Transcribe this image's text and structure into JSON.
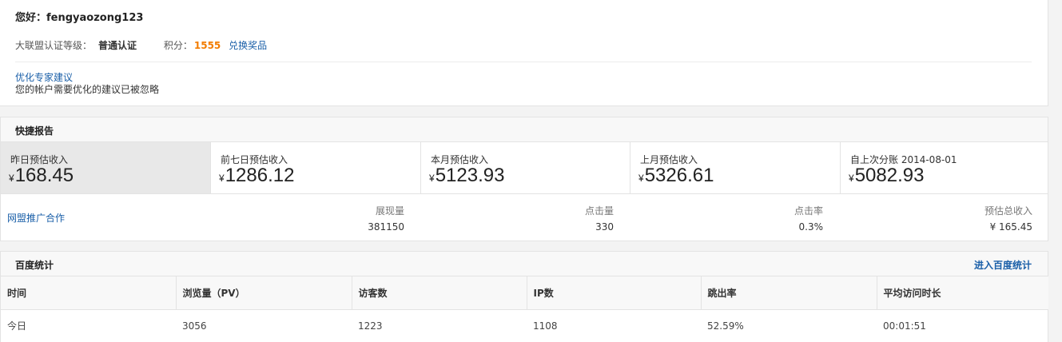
{
  "header": {
    "greeting": "您好：fengyaozong123",
    "level_label": "大联盟认证等级：",
    "level_value": "普通认证",
    "points_label": "积分：",
    "points_value": "1555",
    "redeem_link": "兑换奖品",
    "optimize_link": "优化专家建议",
    "optimize_text": "您的帐户需要优化的建议已被忽略"
  },
  "quick_report": {
    "title": "快捷报告",
    "currency": "¥",
    "cards": [
      {
        "label": "昨日预估收入",
        "value": "168.45",
        "active": true
      },
      {
        "label": "前七日预估收入",
        "value": "1286.12"
      },
      {
        "label": "本月预估收入",
        "value": "5123.93"
      },
      {
        "label": "上月预估收入",
        "value": "5326.61"
      },
      {
        "label": "自上次分账 2014-08-01",
        "value": "5082.93"
      }
    ],
    "union": {
      "link": "网盟推广合作",
      "metrics": [
        {
          "label": "展现量",
          "value": "381150"
        },
        {
          "label": "点击量",
          "value": "330"
        },
        {
          "label": "点击率",
          "value": "0.3%"
        },
        {
          "label": "预估总收入",
          "value": "¥ 165.45"
        }
      ]
    }
  },
  "baidu_stats": {
    "title": "百度统计",
    "enter_link": "进入百度统计",
    "columns": [
      "时间",
      "浏览量（PV）",
      "访客数",
      "IP数",
      "跳出率",
      "平均访问时长"
    ],
    "rows": [
      [
        "今日",
        "3056",
        "1223",
        "1108",
        "52.59%",
        "00:01:51"
      ]
    ]
  }
}
